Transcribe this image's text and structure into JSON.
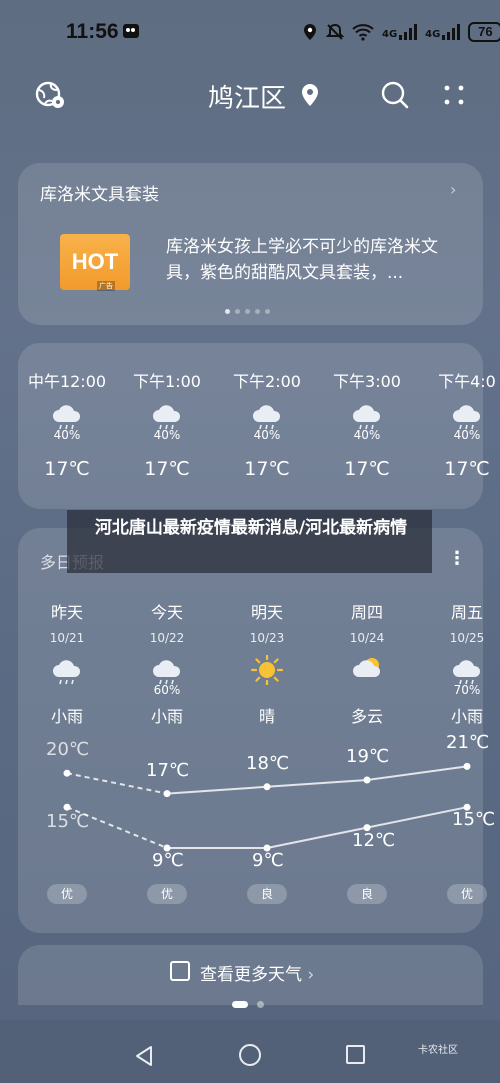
{
  "status_bar": {
    "time": "11:56",
    "signal1": "4G",
    "signal2": "4G",
    "battery": "76"
  },
  "header": {
    "city": "鸠江区"
  },
  "ad": {
    "title": "库洛米文具套装",
    "badge_text": "HOT",
    "ad_tag": "广告",
    "description": "库洛米女孩上学必不可少的库洛米文具，紫色的甜酷风文具套装，..."
  },
  "hourly": [
    {
      "time": "中午12:00",
      "pct": "40%",
      "temp": "17℃"
    },
    {
      "time": "下午1:00",
      "pct": "40%",
      "temp": "17℃"
    },
    {
      "time": "下午2:00",
      "pct": "40%",
      "temp": "17℃"
    },
    {
      "time": "下午3:00",
      "pct": "40%",
      "temp": "17℃"
    },
    {
      "time": "下午4:0",
      "pct": "40%",
      "temp": "17℃"
    }
  ],
  "overlay_title": "河北唐山最新疫情最新消息/河北最新病情",
  "daily": {
    "title": "多日预报",
    "days": [
      {
        "name": "昨天",
        "date": "10/21",
        "pct": "",
        "cond": "小雨",
        "high": "20℃",
        "low": "15℃",
        "aqi": "优",
        "icon": "cloud-rain-icon"
      },
      {
        "name": "今天",
        "date": "10/22",
        "pct": "60%",
        "cond": "小雨",
        "high": "17℃",
        "low": "9℃",
        "aqi": "优",
        "icon": "cloud-rain-icon"
      },
      {
        "name": "明天",
        "date": "10/23",
        "pct": "",
        "cond": "晴",
        "high": "18℃",
        "low": "9℃",
        "aqi": "良",
        "icon": "sun-icon"
      },
      {
        "name": "周四",
        "date": "10/24",
        "pct": "",
        "cond": "多云",
        "high": "19℃",
        "low": "12℃",
        "aqi": "良",
        "icon": "partly-cloudy-icon"
      },
      {
        "name": "周五",
        "date": "10/25",
        "pct": "70%",
        "cond": "小雨",
        "high": "21℃",
        "low": "15℃",
        "aqi": "优",
        "icon": "cloud-rain-icon"
      }
    ]
  },
  "more_weather": "查看更多天气",
  "watermark": "卡农社区"
}
